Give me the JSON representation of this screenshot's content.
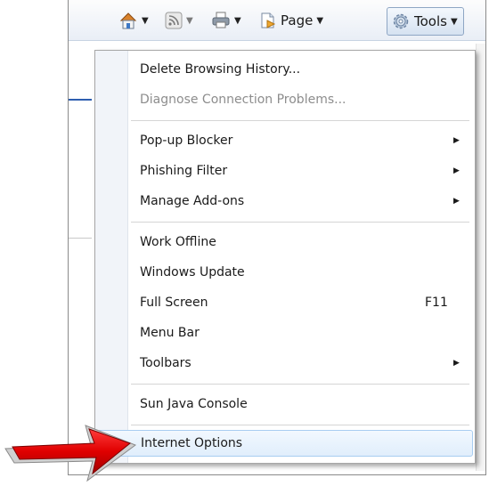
{
  "toolbar": {
    "page_label": "Page",
    "tools_label": "Tools",
    "home_icon": "home-icon",
    "feeds_icon": "rss-feed-icon",
    "print_icon": "printer-icon",
    "page_icon": "page-icon",
    "tools_icon": "gear-icon"
  },
  "menu": {
    "items": [
      {
        "label": "Delete Browsing History..."
      },
      {
        "label": "Diagnose Connection Problems...",
        "disabled": true
      },
      {
        "label": "Pop-up Blocker",
        "submenu": true
      },
      {
        "label": "Phishing Filter",
        "submenu": true
      },
      {
        "label": "Manage Add-ons",
        "submenu": true
      },
      {
        "label": "Work Offline"
      },
      {
        "label": "Windows Update"
      },
      {
        "label": "Full Screen",
        "shortcut": "F11"
      },
      {
        "label": "Menu Bar"
      },
      {
        "label": "Toolbars",
        "submenu": true
      },
      {
        "label": "Sun Java Console"
      },
      {
        "label": "Internet Options",
        "highlighted": true
      }
    ]
  },
  "colors": {
    "highlight_border": "#a8cdf1",
    "arrow_red": "#e00000"
  }
}
